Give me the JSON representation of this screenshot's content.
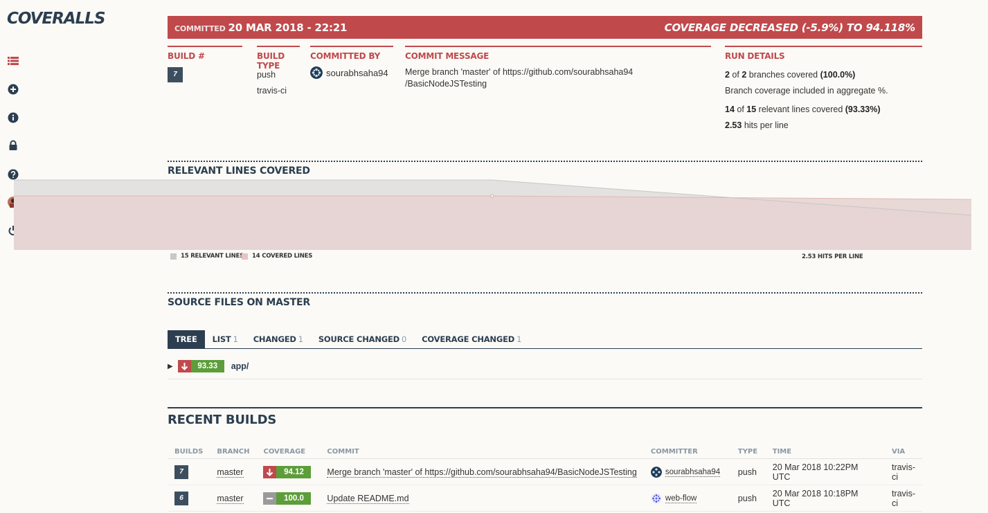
{
  "app": {
    "logo": "COVERALLS"
  },
  "sidebar": {
    "icons": [
      "list-icon",
      "plus-circle-icon",
      "info-circle-icon",
      "lock-icon",
      "question-circle-icon",
      "user-avatar",
      "power-icon"
    ]
  },
  "banner": {
    "committed_label": "COMMITTED",
    "committed_date": "20 MAR 2018 - 22:21",
    "coverage_status": "COVERAGE DECREASED (-5.9%) TO 94.118%",
    "color": "#c0494b"
  },
  "build": {
    "header_build": "BUILD #",
    "number": "7",
    "header_type": "BUILD TYPE",
    "type": "push",
    "service": "travis-ci",
    "header_committed_by": "COMMITTED BY",
    "committer": "sourabhsaha94",
    "header_message": "COMMIT MESSAGE",
    "message_line1": "Merge branch 'master' of https://github.com/sourabhsaha94",
    "message_line2": "/BasicNodeJSTesting",
    "header_run": "RUN DETAILS"
  },
  "run_details": {
    "branches_covered": "2",
    "branches_total": "2",
    "branches_text": "branches covered",
    "branches_pct": "(100.0%)",
    "aggregate_note": "Branch coverage included in aggregate %.",
    "lines_covered": "14",
    "lines_total": "15",
    "lines_text": "relevant lines covered",
    "lines_pct": "(93.33%)",
    "hits": "2.53",
    "hits_text": "hits per line"
  },
  "relevant_lines": {
    "title": "RELEVANT LINES COVERED",
    "legend_relevant": "15 RELEVANT LINES",
    "legend_covered": "14 COVERED LINES",
    "hits_label": "2.53 HITS PER LINE",
    "relevant_color": "#c8c8c8",
    "covered_color": "#e8c4c4"
  },
  "source_files": {
    "title": "SOURCE FILES ON MASTER",
    "tabs": [
      {
        "label": "TREE",
        "count": ""
      },
      {
        "label": "LIST",
        "count": "1"
      },
      {
        "label": "CHANGED",
        "count": "1"
      },
      {
        "label": "SOURCE CHANGED",
        "count": "0"
      },
      {
        "label": "COVERAGE CHANGED",
        "count": "1"
      }
    ],
    "tree_item": {
      "coverage": "93.33",
      "name": "app/"
    }
  },
  "recent_builds": {
    "title": "RECENT BUILDS",
    "columns": [
      "BUILDS",
      "BRANCH",
      "COVERAGE",
      "COMMIT",
      "COMMITTER",
      "TYPE",
      "TIME",
      "VIA"
    ],
    "rows": [
      {
        "build": "7",
        "branch": "master",
        "coverage": "94.12",
        "direction": "down",
        "commit": "Merge branch 'master' of https://github.com/sourabhsaha94/BasicNodeJSTesting",
        "committer": "sourabhsaha94",
        "type": "push",
        "time": "20 Mar 2018 10:22PM UTC",
        "via": "travis-ci"
      },
      {
        "build": "6",
        "branch": "master",
        "coverage": "100.0",
        "direction": "same",
        "commit": "Update README.md",
        "committer": "web-flow",
        "type": "push",
        "time": "20 Mar 2018 10:18PM UTC",
        "via": "travis-ci"
      }
    ]
  }
}
